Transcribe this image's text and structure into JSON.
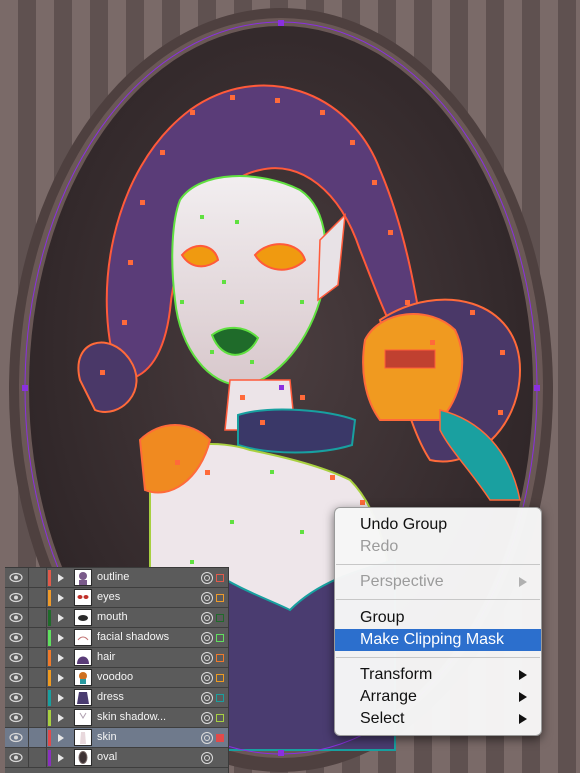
{
  "layers": [
    {
      "name": "outline",
      "color": "#e25a4a",
      "selected": false
    },
    {
      "name": "eyes",
      "color": "#f09a2a",
      "selected": false
    },
    {
      "name": "mouth",
      "color": "#1f6b2a",
      "selected": false
    },
    {
      "name": "facial shadows",
      "color": "#5fe05f",
      "selected": false
    },
    {
      "name": "hair",
      "color": "#f07a2a",
      "selected": false
    },
    {
      "name": "voodoo",
      "color": "#f09a20",
      "selected": false
    },
    {
      "name": "dress",
      "color": "#18a0a0",
      "selected": false
    },
    {
      "name": "skin shadow...",
      "color": "#a8d040",
      "selected": false
    },
    {
      "name": "skin",
      "color": "#e24a4a",
      "selected": true
    },
    {
      "name": "oval",
      "color": "#8a30c0",
      "selected": false
    }
  ],
  "context_menu": {
    "items": [
      {
        "label": "Undo Group",
        "enabled": true,
        "submenu": false
      },
      {
        "label": "Redo",
        "enabled": false,
        "submenu": false
      },
      {
        "label": "Perspective",
        "enabled": false,
        "submenu": true
      },
      {
        "label": "Group",
        "enabled": true,
        "submenu": false
      },
      {
        "label": "Make Clipping Mask",
        "enabled": true,
        "submenu": false,
        "highlighted": true
      },
      {
        "label": "Transform",
        "enabled": true,
        "submenu": true
      },
      {
        "label": "Arrange",
        "enabled": true,
        "submenu": true
      },
      {
        "label": "Select",
        "enabled": true,
        "submenu": true
      }
    ]
  },
  "colors": {
    "stripe_light": "#7a6a68",
    "stripe_dark": "#5f5150",
    "frame": "#5a4a48",
    "oval_fill": "#3d3234",
    "selection_outline": "#ff5a3a",
    "selection_accent": "#60e040",
    "bounding_path": "#8a30e0"
  }
}
